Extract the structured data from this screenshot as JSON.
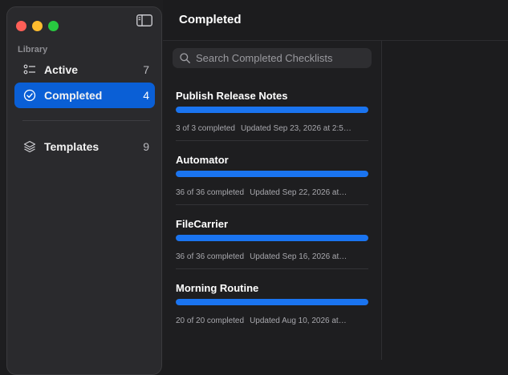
{
  "sidebar": {
    "section": "Library",
    "items": [
      {
        "label": "Active",
        "count": "7",
        "icon": "checklist-icon"
      },
      {
        "label": "Completed",
        "count": "4",
        "icon": "checkmark-circle-icon",
        "selected": true
      },
      {
        "label": "Templates",
        "count": "9",
        "icon": "layers-icon"
      }
    ]
  },
  "header": {
    "title": "Completed"
  },
  "search": {
    "placeholder": "Search Completed Checklists"
  },
  "checklists": [
    {
      "name": "Publish Release Notes",
      "done": 3,
      "total": 3,
      "progress_text": "3 of 3 completed",
      "updated": "Updated Sep 23, 2026 at 2:5…"
    },
    {
      "name": "Automator",
      "done": 36,
      "total": 36,
      "progress_text": "36 of 36 completed",
      "updated": "Updated Sep 22, 2026 at…"
    },
    {
      "name": "FileCarrier",
      "done": 36,
      "total": 36,
      "progress_text": "36 of 36 completed",
      "updated": "Updated Sep 16, 2026 at…"
    },
    {
      "name": "Morning Routine",
      "done": 20,
      "total": 20,
      "progress_text": "20 of 20 completed",
      "updated": "Updated Aug 10, 2026 at…"
    }
  ],
  "colors": {
    "accent": "#0a5fd6",
    "progress": "#1a74f0",
    "close": "#ff5f57",
    "minimize": "#febc2e",
    "zoom": "#28c840"
  }
}
